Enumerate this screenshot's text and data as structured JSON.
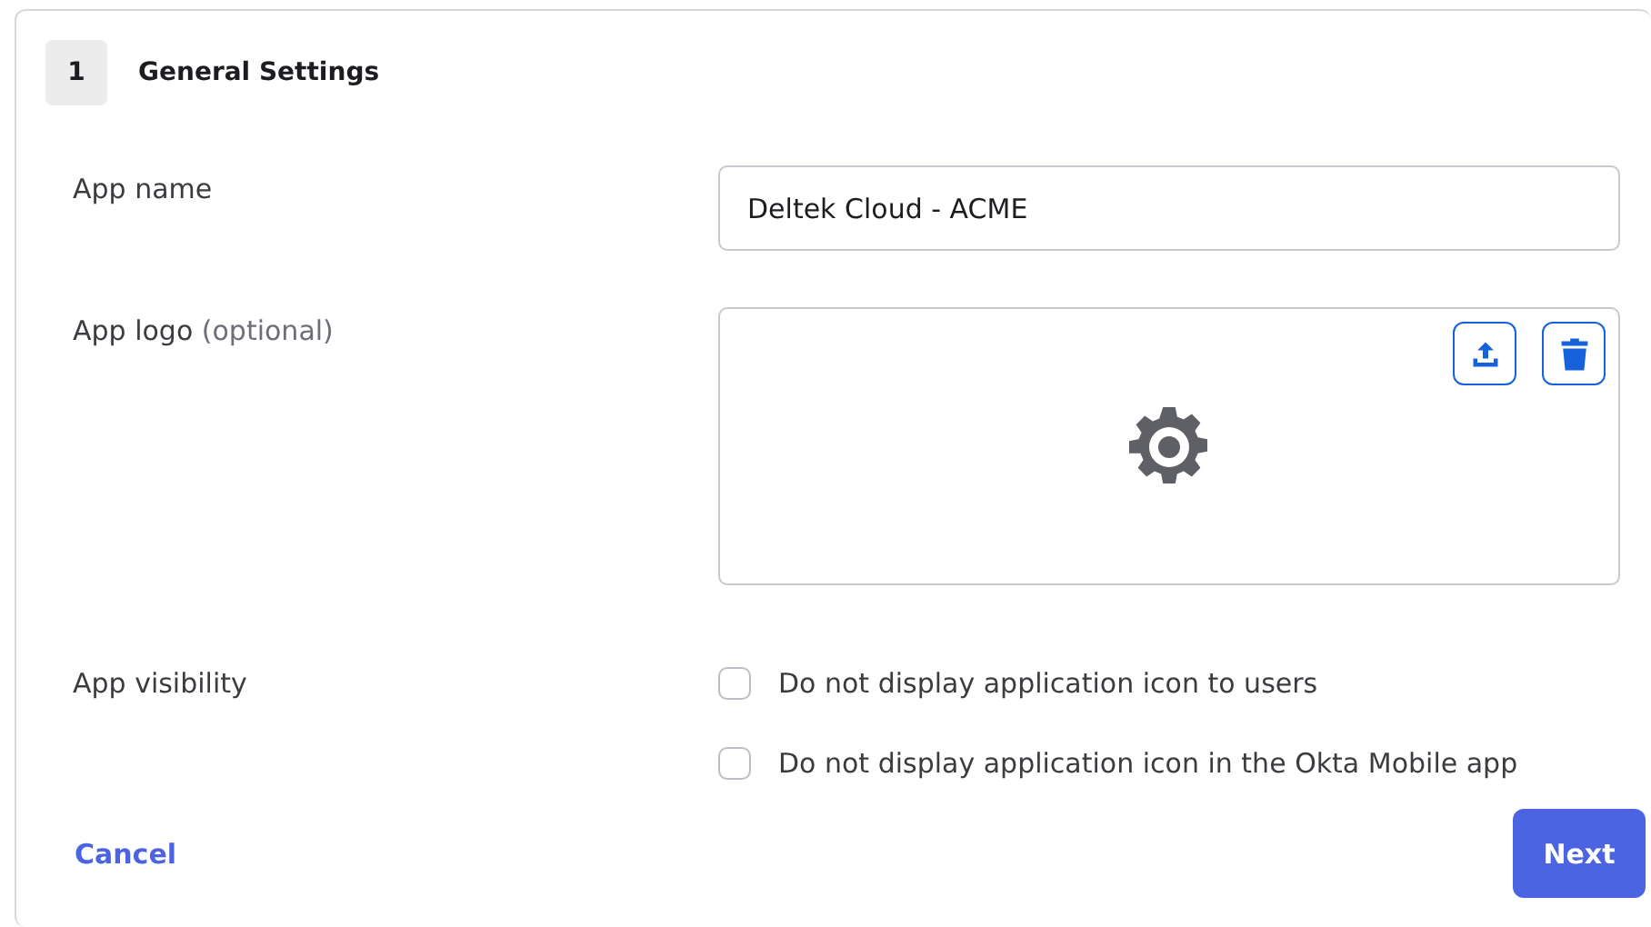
{
  "section": {
    "step": "1",
    "title": "General Settings"
  },
  "app_name": {
    "label": "App name",
    "value": "Deltek Cloud - ACME"
  },
  "app_logo": {
    "label": "App logo",
    "hint": "(optional)"
  },
  "app_visibility": {
    "label": "App visibility",
    "options": [
      {
        "label": "Do not display application icon to users",
        "checked": false
      },
      {
        "label": "Do not display application icon in the Okta Mobile app",
        "checked": false
      }
    ]
  },
  "buttons": {
    "cancel": "Cancel",
    "next": "Next"
  }
}
